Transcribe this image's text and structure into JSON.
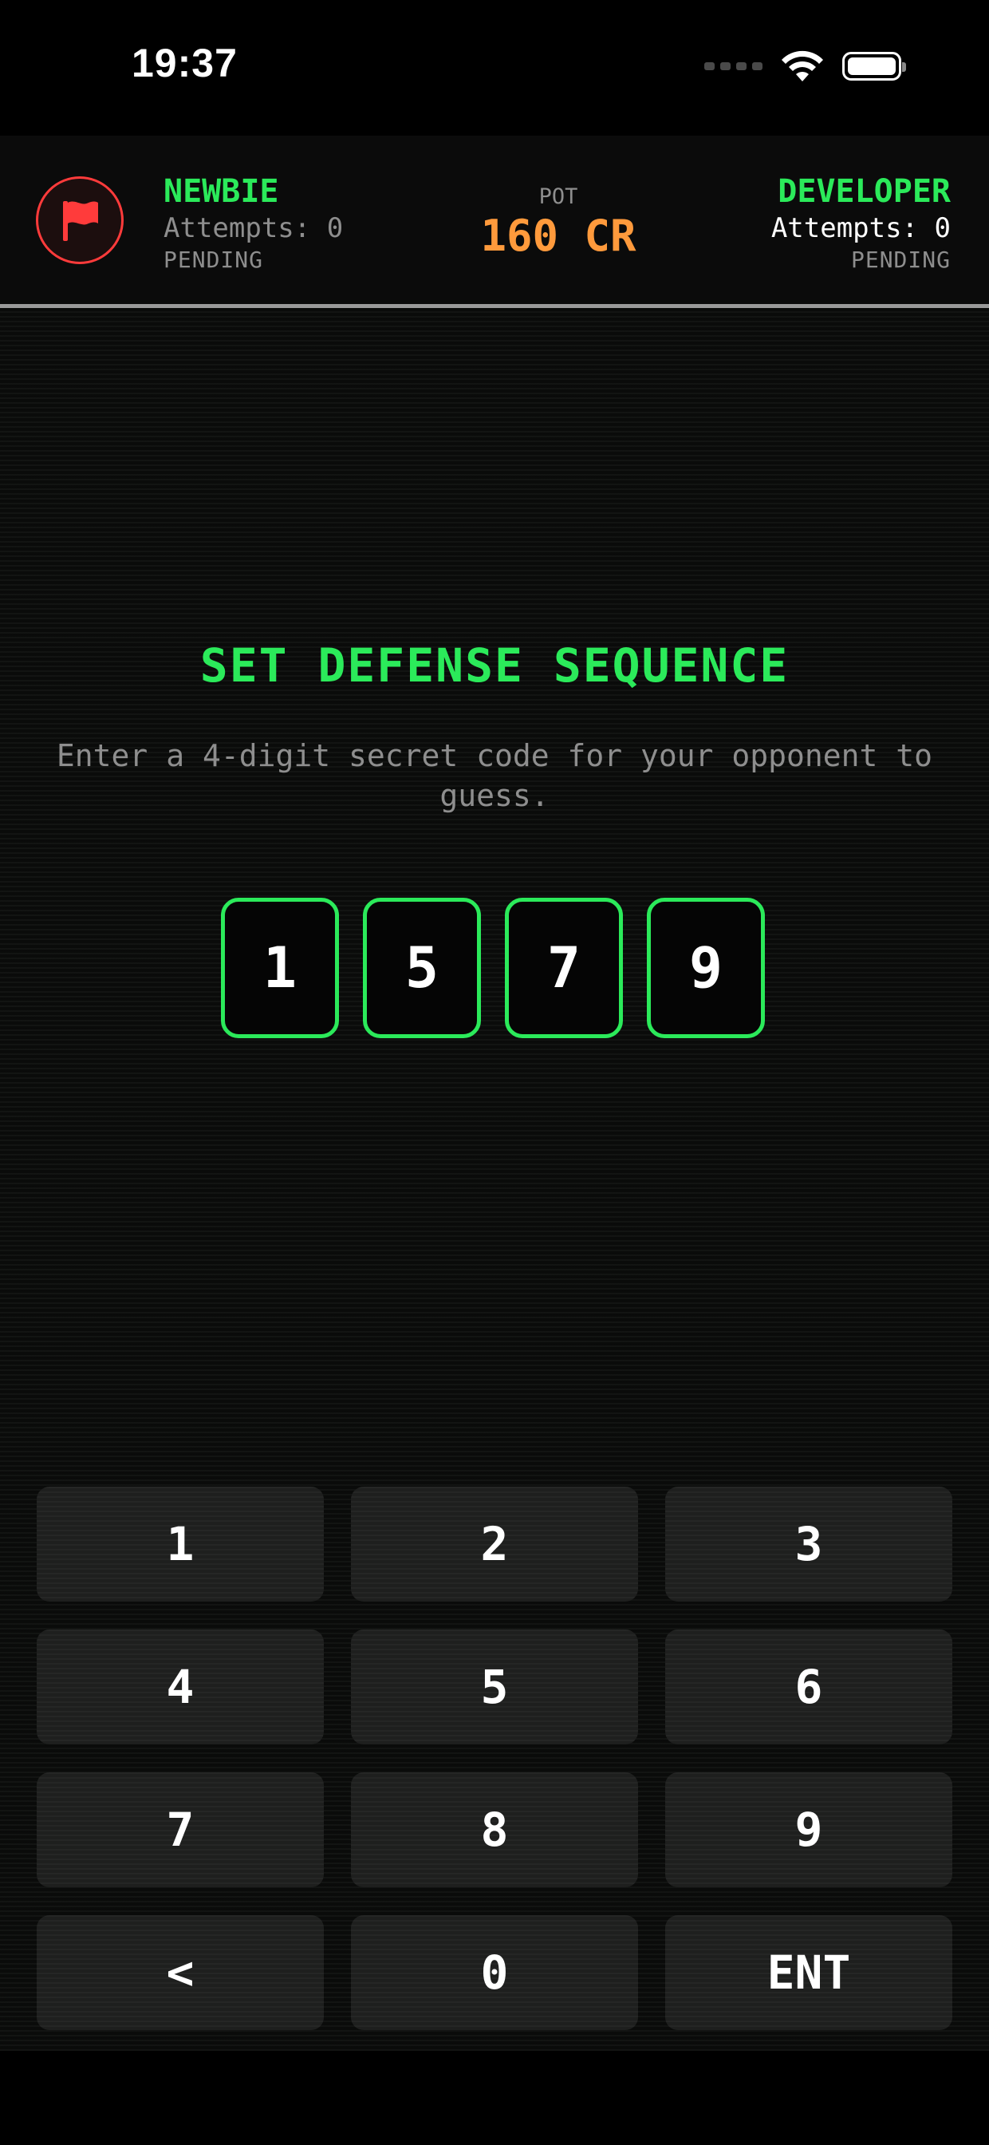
{
  "status_bar": {
    "time": "19:37"
  },
  "header": {
    "player_left": {
      "name": "NEWBIE",
      "attempts": "Attempts: 0",
      "status": "PENDING"
    },
    "pot": {
      "label": "POT",
      "value": "160 CR"
    },
    "player_right": {
      "name": "DEVELOPER",
      "attempts": "Attempts: 0",
      "status": "PENDING"
    },
    "flag_icon": "flag-icon"
  },
  "main": {
    "title": "SET DEFENSE SEQUENCE",
    "subtitle": "Enter a 4-digit secret code for your opponent to guess.",
    "code_digits": [
      "1",
      "5",
      "7",
      "9"
    ]
  },
  "keypad": {
    "keys": [
      "1",
      "2",
      "3",
      "4",
      "5",
      "6",
      "7",
      "8",
      "9",
      "<",
      "0",
      "ENT"
    ]
  },
  "colors": {
    "accent_green": "#2bea5a",
    "pot_orange": "#ff9a3c",
    "flag_red": "#ff3b3b",
    "muted_gray": "#8e8e8e"
  }
}
